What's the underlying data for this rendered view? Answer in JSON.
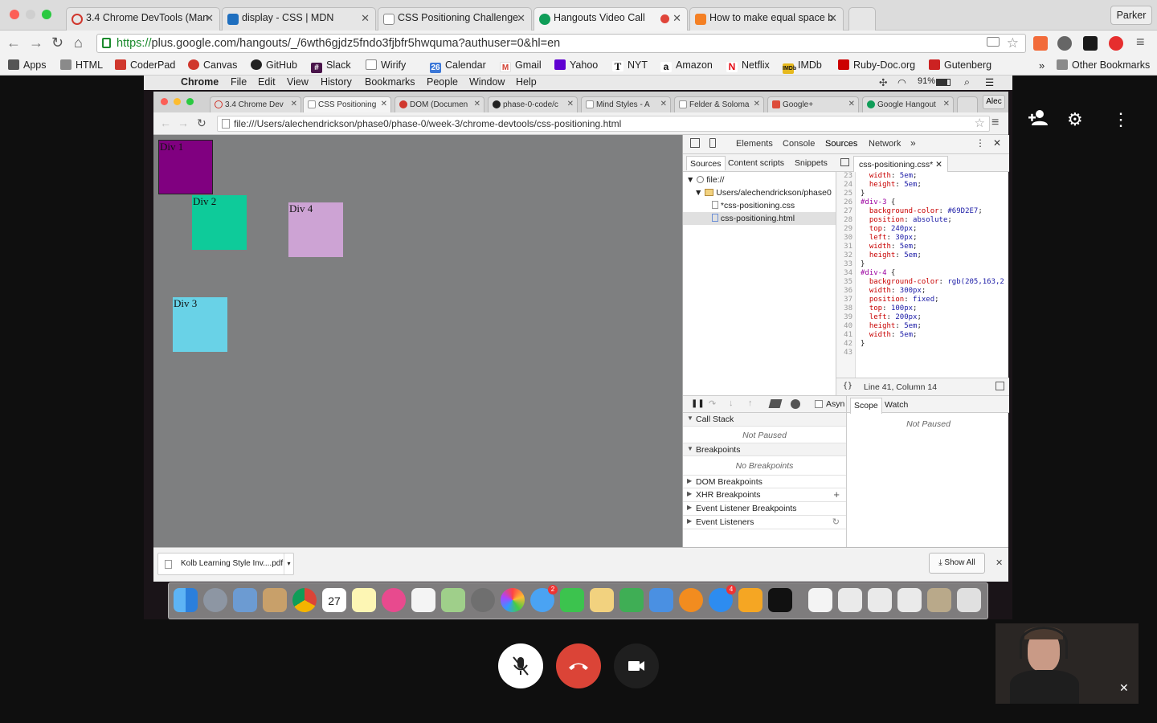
{
  "outer_browser": {
    "tabs": [
      {
        "label": "3.4 Chrome DevTools (Man",
        "icon": "devbootcamp-icon",
        "color": "#d0372d"
      },
      {
        "label": "display - CSS | MDN",
        "icon": "mdn-icon",
        "color": "#1f6fbf"
      },
      {
        "label": "CSS Positioning Challenge",
        "icon": "document-icon",
        "color": "#888888"
      },
      {
        "label": "Hangouts Video Call",
        "icon": "hangouts-icon",
        "color": "#0f9d58"
      },
      {
        "label": "How to make equal space b",
        "icon": "stackoverflow-icon",
        "color": "#f48024"
      }
    ],
    "profile": "Parker",
    "url_scheme": "https://",
    "url_rest": "plus.google.com/hangouts/_/6wth6gjdz5fndo3fjbfr5hwquma?authuser=0&hl=en",
    "bookmarks": [
      {
        "label": "Apps",
        "icon": "apps-grid-icon",
        "color": "#555555"
      },
      {
        "label": "HTML",
        "icon": "folder-icon",
        "color": "#7a7a7a"
      },
      {
        "label": "CoderPad",
        "icon": "coderpad-icon",
        "color": "#d0372d"
      },
      {
        "label": "Canvas",
        "icon": "canvas-icon",
        "color": "#d0372d"
      },
      {
        "label": "GitHub",
        "icon": "github-icon",
        "color": "#222222"
      },
      {
        "label": "Slack",
        "icon": "slack-icon",
        "color": "#4a154b"
      },
      {
        "label": "Wirify",
        "icon": "document-icon",
        "color": "#777777"
      },
      {
        "label": "Calendar",
        "icon": "calendar-icon",
        "color": "#3c78d8"
      },
      {
        "label": "Gmail",
        "icon": "gmail-icon",
        "color": "#d23f31"
      },
      {
        "label": "Yahoo",
        "icon": "yahoo-icon",
        "color": "#5f01d1"
      },
      {
        "label": "NYT",
        "icon": "nyt-icon",
        "color": "#111111"
      },
      {
        "label": "Amazon",
        "icon": "amazon-icon",
        "color": "#111111"
      },
      {
        "label": "Netflix",
        "icon": "netflix-icon",
        "color": "#e50914"
      },
      {
        "label": "IMDb",
        "icon": "imdb-icon",
        "color": "#e6b91e"
      },
      {
        "label": "Ruby-Doc.org",
        "icon": "ruby-icon",
        "color": "#cc0000"
      },
      {
        "label": "Gutenberg",
        "icon": "gutenberg-icon",
        "color": "#cc2222"
      }
    ],
    "other_bookmarks": "Other Bookmarks",
    "overflow": "»"
  },
  "mac_menu": {
    "items": [
      "Chrome",
      "File",
      "Edit",
      "View",
      "History",
      "Bookmarks",
      "People",
      "Window",
      "Help"
    ],
    "battery": "91%"
  },
  "inner_browser": {
    "tabs": [
      {
        "label": "3.4 Chrome Dev",
        "color": "#d0372d"
      },
      {
        "label": "CSS Positioning",
        "color": "#999999"
      },
      {
        "label": "DOM (Documen",
        "color": "#d0372d"
      },
      {
        "label": "phase-0-code/c",
        "color": "#222222"
      },
      {
        "label": "Mind Styles - A",
        "color": "#999999"
      },
      {
        "label": "Felder & Soloma",
        "color": "#999999"
      },
      {
        "label": "Google+",
        "color": "#dd4b39"
      },
      {
        "label": "Google Hangout",
        "color": "#0f9d58"
      }
    ],
    "profile": "Alec",
    "url": "file:///Users/alechendrickson/phase0/phase-0/week-3/chrome-devtools/css-positioning.html"
  },
  "page_boxes": [
    {
      "label": "Div 1",
      "color": "#800080"
    },
    {
      "label": "Div 2",
      "color": "#0ecb9a"
    },
    {
      "label": "Div 4",
      "color": "#cda3d4"
    },
    {
      "label": "Div 3",
      "color": "#69d2e7"
    }
  ],
  "devtools": {
    "tabs": [
      "Elements",
      "Console",
      "Sources",
      "Network"
    ],
    "active_tab": "Sources",
    "nav_tabs": [
      "Sources",
      "Content scripts",
      "Snippets"
    ],
    "file_tab": "css-positioning.css*",
    "tree": [
      "file://",
      "Users/alechendrickson/phase0",
      "*css-positioning.css",
      "css-positioning.html"
    ],
    "line_numbers": [
      "23",
      "24",
      "25",
      "26",
      "27",
      "28",
      "29",
      "30",
      "31",
      "32",
      "33",
      "34",
      "35",
      "36",
      "37",
      "38",
      "39",
      "40",
      "41",
      "42",
      "43"
    ],
    "status": "Line 41, Column 14",
    "async_label": "Asyn",
    "scope_tabs": [
      "Scope",
      "Watch"
    ],
    "sections": {
      "call_stack": "Call Stack",
      "not_paused": "Not Paused",
      "breakpoints": "Breakpoints",
      "no_breakpoints": "No Breakpoints",
      "dom_breakpoints": "DOM Breakpoints",
      "xhr_breakpoints": "XHR Breakpoints",
      "event_listener_breakpoints": "Event Listener Breakpoints",
      "event_listeners": "Event Listeners"
    }
  },
  "download": {
    "file": "Kolb Learning Style Inv....pdf",
    "show_all": "Show All"
  },
  "dock": {
    "calendar_day": "27",
    "calendar_month": "FEB",
    "messages_badge": "2",
    "appstore_badge": "4"
  },
  "hangouts": {
    "colors": {
      "end_call": "#db4437",
      "mic": "#ffffff",
      "camera": "#1f1f1f"
    }
  }
}
